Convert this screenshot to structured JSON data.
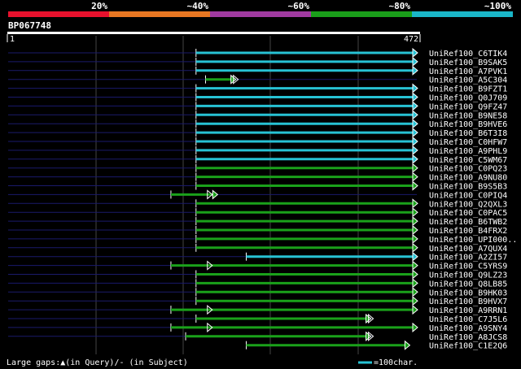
{
  "identity_scale": {
    "labels": [
      "20%",
      "~40%",
      "~60%",
      "~80%",
      "~100%"
    ],
    "colors": [
      "#e8112d",
      "#e87722",
      "#a03aa0",
      "#1a9e1a",
      "#1ab6c8"
    ]
  },
  "query": {
    "id": "BP067748",
    "start_label": "1",
    "end_label": "472",
    "length": 472
  },
  "hits": [
    {
      "name": "UniRef100_C6TIK4",
      "color": "cyan",
      "qs": 0,
      "qe": 472,
      "start": 217,
      "end": 472
    },
    {
      "name": "UniRef100_B9SAK5",
      "color": "cyan",
      "qs": 0,
      "qe": 472,
      "start": 217,
      "end": 472
    },
    {
      "name": "UniRef100_A7PVK1",
      "color": "cyan",
      "qs": 0,
      "qe": 472,
      "start": 217,
      "end": 472
    },
    {
      "name": "UniRef100_A5C304",
      "color": "green",
      "qs": 0,
      "qe": 472,
      "start": 228,
      "end": 262
    },
    {
      "name": "UniRef100_B9FZT1",
      "color": "cyan",
      "qs": 0,
      "qe": 472,
      "start": 217,
      "end": 472
    },
    {
      "name": "UniRef100_Q0J709",
      "color": "cyan",
      "qs": 0,
      "qe": 472,
      "start": 217,
      "end": 472
    },
    {
      "name": "UniRef100_Q9FZ47",
      "color": "cyan",
      "qs": 0,
      "qe": 472,
      "start": 217,
      "end": 472
    },
    {
      "name": "UniRef100_B9NE58",
      "color": "cyan",
      "qs": 0,
      "qe": 472,
      "start": 217,
      "end": 472
    },
    {
      "name": "UniRef100_B9HVE6",
      "color": "cyan",
      "qs": 0,
      "qe": 472,
      "start": 217,
      "end": 472
    },
    {
      "name": "UniRef100_B6T3I8",
      "color": "cyan",
      "qs": 0,
      "qe": 472,
      "start": 217,
      "end": 472
    },
    {
      "name": "UniRef100_C0HFW7",
      "color": "cyan",
      "qs": 0,
      "qe": 472,
      "start": 217,
      "end": 472
    },
    {
      "name": "UniRef100_A9PHL9",
      "color": "cyan",
      "qs": 0,
      "qe": 472,
      "start": 217,
      "end": 472
    },
    {
      "name": "UniRef100_C5WM67",
      "color": "cyan",
      "qs": 0,
      "qe": 472,
      "start": 217,
      "end": 472
    },
    {
      "name": "UniRef100_C0PQ23",
      "color": "green",
      "qs": 0,
      "qe": 472,
      "start": 217,
      "end": 472
    },
    {
      "name": "UniRef100_A9NU80",
      "color": "green",
      "qs": 0,
      "qe": 472,
      "start": 217,
      "end": 472
    },
    {
      "name": "UniRef100_B9S5B3",
      "color": "green",
      "qs": 0,
      "qe": 472,
      "start": 217,
      "end": 472
    },
    {
      "name": "UniRef100_C0PIQ4",
      "color": "green",
      "qs": 0,
      "qe": 472,
      "start": 188,
      "end": 241
    },
    {
      "name": "UniRef100_Q2QXL3",
      "color": "green",
      "qs": 0,
      "qe": 472,
      "start": 217,
      "end": 472
    },
    {
      "name": "UniRef100_C0PAC5",
      "color": "green",
      "qs": 0,
      "qe": 472,
      "start": 217,
      "end": 472
    },
    {
      "name": "UniRef100_B6TWB2",
      "color": "green",
      "qs": 0,
      "qe": 472,
      "start": 217,
      "end": 472
    },
    {
      "name": "UniRef100_B4FRX2",
      "color": "green",
      "qs": 0,
      "qe": 472,
      "start": 217,
      "end": 472
    },
    {
      "name": "UniRef100_UPI000..",
      "color": "green",
      "qs": 0,
      "qe": 472,
      "start": 217,
      "end": 472
    },
    {
      "name": "UniRef100_A7QUX4",
      "color": "green",
      "qs": 0,
      "qe": 472,
      "start": 217,
      "end": 472
    },
    {
      "name": "UniRef100_A2ZI57",
      "color": "cyan",
      "qs": 0,
      "qe": 472,
      "start": 275,
      "end": 472
    },
    {
      "name": "UniRef100_C5YRS9",
      "color": "green",
      "qs": 0,
      "qe": 472,
      "start": 188,
      "end": 472
    },
    {
      "name": "UniRef100_Q9LZ23",
      "color": "green",
      "qs": 0,
      "qe": 472,
      "start": 217,
      "end": 472
    },
    {
      "name": "UniRef100_Q8LB85",
      "color": "green",
      "qs": 0,
      "qe": 472,
      "start": 217,
      "end": 472
    },
    {
      "name": "UniRef100_B9HK03",
      "color": "green",
      "qs": 0,
      "qe": 472,
      "start": 217,
      "end": 472
    },
    {
      "name": "UniRef100_B9HVX7",
      "color": "green",
      "qs": 0,
      "qe": 472,
      "start": 217,
      "end": 472
    },
    {
      "name": "UniRef100_A9RRN1",
      "color": "green",
      "qs": 0,
      "qe": 472,
      "start": 188,
      "end": 472
    },
    {
      "name": "UniRef100_C7J5L6",
      "color": "green",
      "qs": 0,
      "qe": 420,
      "start": 217,
      "end": 418
    },
    {
      "name": "UniRef100_A9SNY4",
      "color": "green",
      "qs": 0,
      "qe": 472,
      "start": 188,
      "end": 472
    },
    {
      "name": "UniRef100_A8JCS8",
      "color": "green",
      "qs": 0,
      "qe": 420,
      "start": 205,
      "end": 418
    },
    {
      "name": "UniRef100_C1E2Q6",
      "color": "green",
      "qs": 275,
      "qe": 463,
      "start": 275,
      "end": 463
    }
  ],
  "gap_markers": [
    {
      "row": 3,
      "pos": 262
    },
    {
      "row": 16,
      "pos": 232
    },
    {
      "row": 24,
      "pos": 232
    },
    {
      "row": 29,
      "pos": 232
    },
    {
      "row": 31,
      "pos": 232
    },
    {
      "row": 30,
      "pos": 418
    },
    {
      "row": 32,
      "pos": 418
    }
  ],
  "footer": {
    "legend_text": "Large gaps:▲(in Query)/- (in Subject)",
    "scale_text": "=100char."
  },
  "colors": {
    "cyan": "#27c2d4",
    "green": "#1aa11a",
    "navy": "#1a1a6b",
    "grid": "#444444"
  }
}
